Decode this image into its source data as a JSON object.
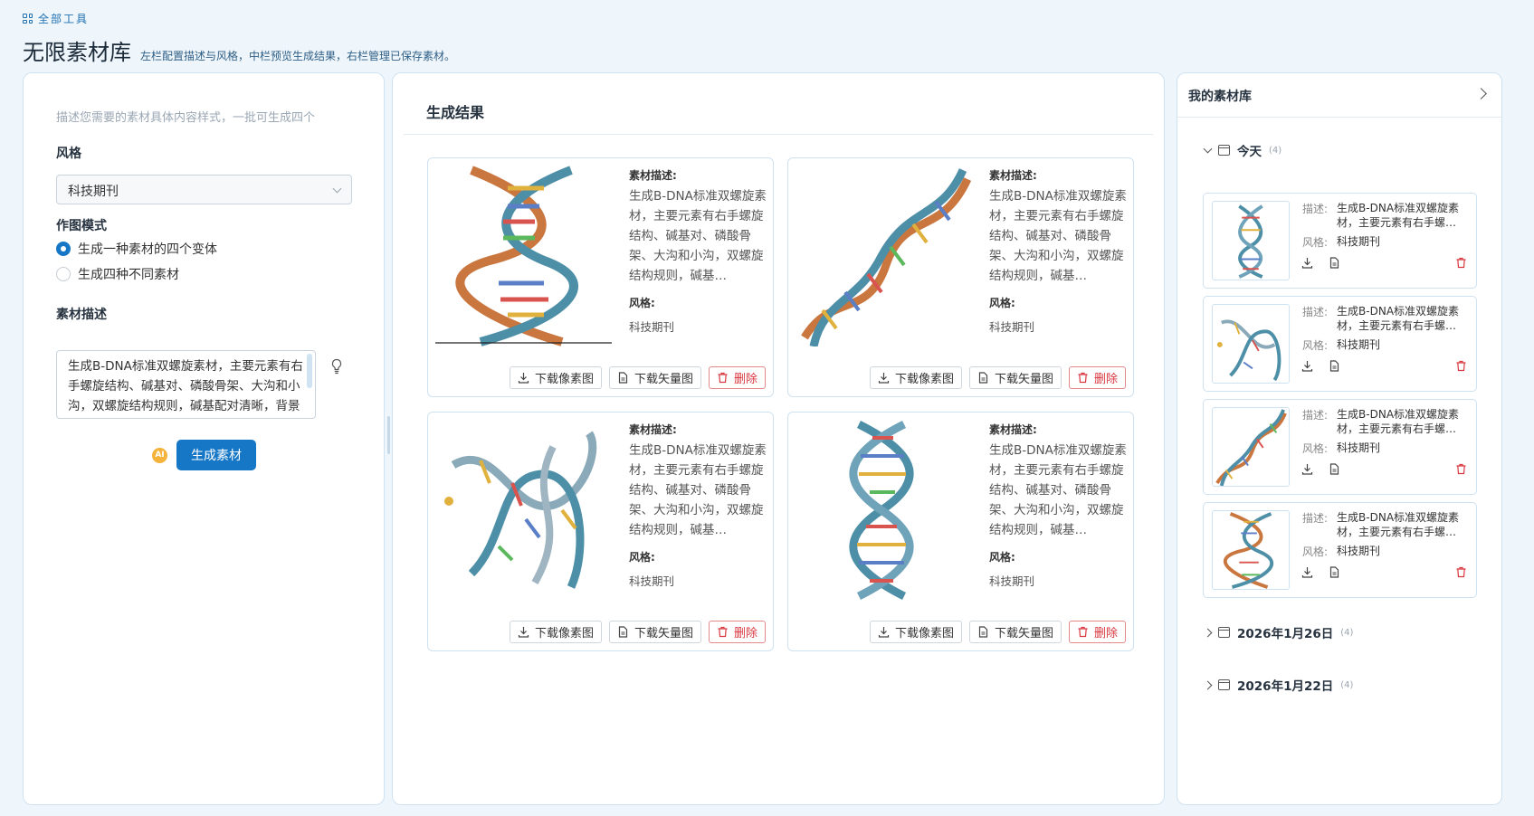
{
  "topbar": {
    "all_tools": "全部工具",
    "title": "无限素材库",
    "subtitle": "左栏配置描述与风格，中栏预览生成结果，右栏管理已保存素材。"
  },
  "left": {
    "description_hint": "描述您需要的素材具体内容样式，一批可生成四个",
    "style_label": "风格",
    "style_value": "科技期刊",
    "mode_label": "作图模式",
    "mode_options": [
      {
        "label": "生成一种素材的四个变体",
        "selected": true
      },
      {
        "label": "生成四种不同素材",
        "selected": false
      }
    ],
    "desc_label": "素材描述",
    "desc_value": "生成B-DNA标准双螺旋素材，主要元素有右手螺旋结构、碱基对、磷酸骨架、大沟和小沟，双螺旋结构规则，碱基配对清晰，背景简洁的科技期刊插图",
    "ai_badge": "AI",
    "generate_label": "生成素材"
  },
  "middle": {
    "title": "生成结果",
    "desc_key": "素材描述:",
    "style_key": "风格:",
    "cards": [
      {
        "desc": "生成B-DNA标准双螺旋素材，主要元素有右手螺旋结构、碱基对、磷酸骨架、大沟和小沟，双螺旋结构规则，碱基…",
        "style": "科技期刊"
      },
      {
        "desc": "生成B-DNA标准双螺旋素材，主要元素有右手螺旋结构、碱基对、磷酸骨架、大沟和小沟，双螺旋结构规则，碱基…",
        "style": "科技期刊"
      },
      {
        "desc": "生成B-DNA标准双螺旋素材，主要元素有右手螺旋结构、碱基对、磷酸骨架、大沟和小沟，双螺旋结构规则，碱基…",
        "style": "科技期刊"
      },
      {
        "desc": "生成B-DNA标准双螺旋素材，主要元素有右手螺旋结构、碱基对、磷酸骨架、大沟和小沟，双螺旋结构规则，碱基…",
        "style": "科技期刊"
      }
    ],
    "btn_download_raster": "下载像素图",
    "btn_download_vector": "下载矢量图",
    "btn_delete": "删除"
  },
  "right": {
    "title": "我的素材库",
    "groups": [
      {
        "label": "今天",
        "count": "(4)",
        "expanded": true
      },
      {
        "label": "2026年1月26日",
        "count": "(4)",
        "expanded": false
      },
      {
        "label": "2026年1月22日",
        "count": "(4)",
        "expanded": false
      }
    ],
    "desc_key": "描述:",
    "style_key": "风格:",
    "items": [
      {
        "desc": "生成B-DNA标准双螺旋素材，主要元素有右手螺…",
        "style": "科技期刊"
      },
      {
        "desc": "生成B-DNA标准双螺旋素材，主要元素有右手螺…",
        "style": "科技期刊"
      },
      {
        "desc": "生成B-DNA标准双螺旋素材，主要元素有右手螺…",
        "style": "科技期刊"
      },
      {
        "desc": "生成B-DNA标准双螺旋素材，主要元素有右手螺…",
        "style": "科技期刊"
      }
    ]
  },
  "colors": {
    "accent": "#1677c6",
    "danger": "#d9363e",
    "border": "#cfe2f1",
    "background": "#eef5fb"
  }
}
